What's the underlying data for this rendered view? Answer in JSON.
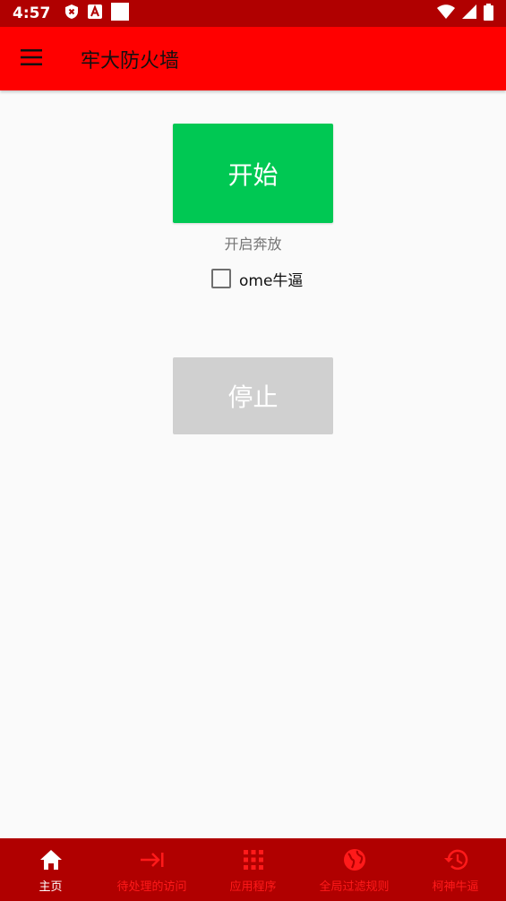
{
  "status_bar": {
    "time": "4:57",
    "left_icons": [
      "shield-x-icon",
      "font-a-icon",
      "blank-square-icon"
    ],
    "right_icons": [
      "wifi-icon",
      "signal-icon",
      "battery-icon"
    ]
  },
  "app_bar": {
    "menu_icon": "hamburger-menu-icon",
    "title": "牢大防火墙"
  },
  "main": {
    "start_button": "开始",
    "start_caption": "开启奔放",
    "checkbox_label": "ome牛逼",
    "checkbox_checked": false,
    "stop_button": "停止"
  },
  "bottom_nav": {
    "items": [
      {
        "label": "主页",
        "icon": "home-icon",
        "active": true
      },
      {
        "label": "待处理的访问",
        "icon": "arrow-to-bar-icon",
        "active": false
      },
      {
        "label": "应用程序",
        "icon": "apps-grid-icon",
        "active": false
      },
      {
        "label": "全局过滤规则",
        "icon": "globe-icon",
        "active": false
      },
      {
        "label": "柯神牛逼",
        "icon": "history-icon",
        "active": false
      }
    ]
  },
  "colors": {
    "status_bar": "#b00000",
    "app_bar": "#ff0000",
    "start_button": "#00c853",
    "stop_button": "#d0d0d0",
    "bottom_nav": "#b00000",
    "nav_inactive": "#ff1a1a",
    "nav_active": "#ffffff"
  }
}
